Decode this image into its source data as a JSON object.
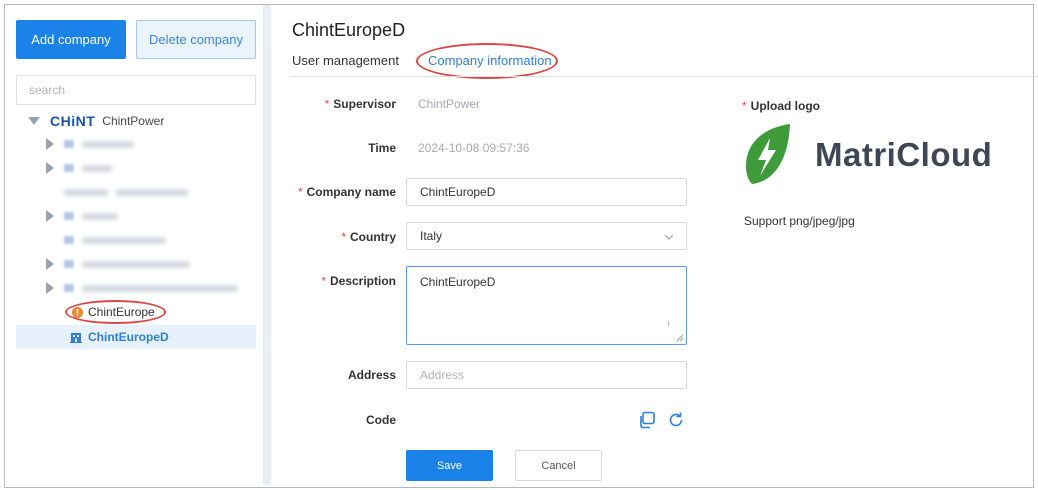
{
  "sidebar": {
    "add_company_label": "Add company",
    "delete_company_label": "Delete company",
    "search_placeholder": "search",
    "root_logo": "CHiNT",
    "root_label": "ChintPower",
    "child_highlighted": "ChintEurope",
    "child_selected": "ChintEuropeD"
  },
  "header": {
    "title": "ChintEuropeD",
    "tabs": [
      {
        "label": "User management",
        "active": false
      },
      {
        "label": "Company information",
        "active": true
      }
    ]
  },
  "form": {
    "supervisor_label": "Supervisor",
    "supervisor_value": "ChintPower",
    "time_label": "Time",
    "time_value": "2024-10-08  09:57:36",
    "company_name_label": "Company name",
    "company_name_value": "ChintEuropeD",
    "country_label": "Country",
    "country_value": "Italy",
    "description_label": "Description",
    "description_value": "ChintEuropeD",
    "address_label": "Address",
    "address_placeholder": "Address",
    "code_label": "Code",
    "save_label": "Save",
    "cancel_label": "Cancel"
  },
  "logo": {
    "upload_label": "Upload logo",
    "brand_text": "MatriCloud",
    "support_text": "Support png/jpeg/jpg"
  },
  "colors": {
    "primary": "#1a82e8",
    "required": "#e64646",
    "highlight_ring": "#d84a4a",
    "leaf_green": "#3f9a3a"
  }
}
